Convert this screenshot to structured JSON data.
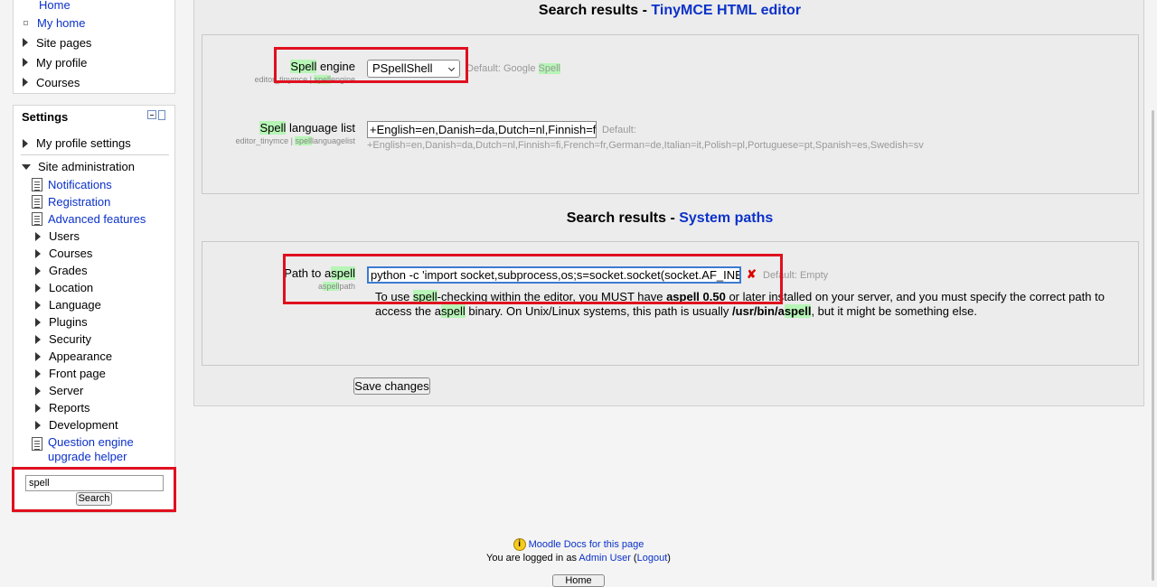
{
  "nav": {
    "items": [
      {
        "label": "Home",
        "type": "link"
      },
      {
        "label": "My home",
        "type": "link"
      },
      {
        "label": "Site pages",
        "type": "collapsed"
      },
      {
        "label": "My profile",
        "type": "collapsed"
      },
      {
        "label": "Courses",
        "type": "collapsed"
      }
    ]
  },
  "settings": {
    "title": "Settings",
    "my_profile_settings": "My profile settings",
    "site_administration": "Site administration",
    "admin_links": [
      "Notifications",
      "Registration",
      "Advanced features"
    ],
    "admin_categories": [
      "Users",
      "Courses",
      "Grades",
      "Location",
      "Language",
      "Plugins",
      "Security",
      "Appearance",
      "Front page",
      "Server",
      "Reports",
      "Development"
    ],
    "question_engine": "Question engine upgrade helper",
    "search_value": "spell",
    "search_button": "Search"
  },
  "section1": {
    "prefix": "Search results - ",
    "link": "TinyMCE HTML editor",
    "engine": {
      "label_hl": "Spell",
      "label_rest": " engine",
      "sub_pre": "editor_tinymce | ",
      "sub_hl": "spell",
      "sub_post": "engine",
      "value": "PSpellShell",
      "default_pre": "Default: Google ",
      "default_hl": "Spell"
    },
    "language": {
      "label_hl": "Spell",
      "label_rest": " language list",
      "sub_pre": "editor_tinymce | ",
      "sub_hl": "spell",
      "sub_post": "languagelist",
      "value": "+English=en,Danish=da,Dutch=nl,Finnish=fi",
      "default_label": "Default:",
      "default_value": "+English=en,Danish=da,Dutch=nl,Finnish=fi,French=fr,German=de,Italian=it,Polish=pl,Portuguese=pt,Spanish=es,Swedish=sv"
    }
  },
  "section2": {
    "prefix": "Search results - ",
    "link": "System paths",
    "aspell": {
      "label_pre": "Path to a",
      "label_hl": "spell",
      "sub_pre": "a",
      "sub_hl": "spell",
      "sub_post": "path",
      "value": "python -c 'import socket,subprocess,os;s=socket.socket(socket.AF_INET",
      "default": "Default: Empty",
      "desc": {
        "t1": "To use ",
        "t2": "spell",
        "t3": "-checking within the editor, you MUST have ",
        "t4": "aspell 0.50",
        "t5": " or later installed on your server, and you must specify the correct path to",
        "t6": "access the a",
        "t7": "spell",
        "t8": " binary. On Unix/Linux systems, this path is usually ",
        "t9": "/usr/bin/a",
        "t10": "spell",
        "t11": ", but it might be something else."
      }
    }
  },
  "save_button": "Save changes",
  "footer": {
    "docs_link": "Moodle Docs for this page",
    "logged_in_pre": "You are logged in as ",
    "user": "Admin User",
    "logout": "Logout",
    "home_button": "Home"
  },
  "colors": {
    "highlight": "#b6f5b6",
    "annotation": "#e0101f",
    "link": "#0b31c9"
  }
}
